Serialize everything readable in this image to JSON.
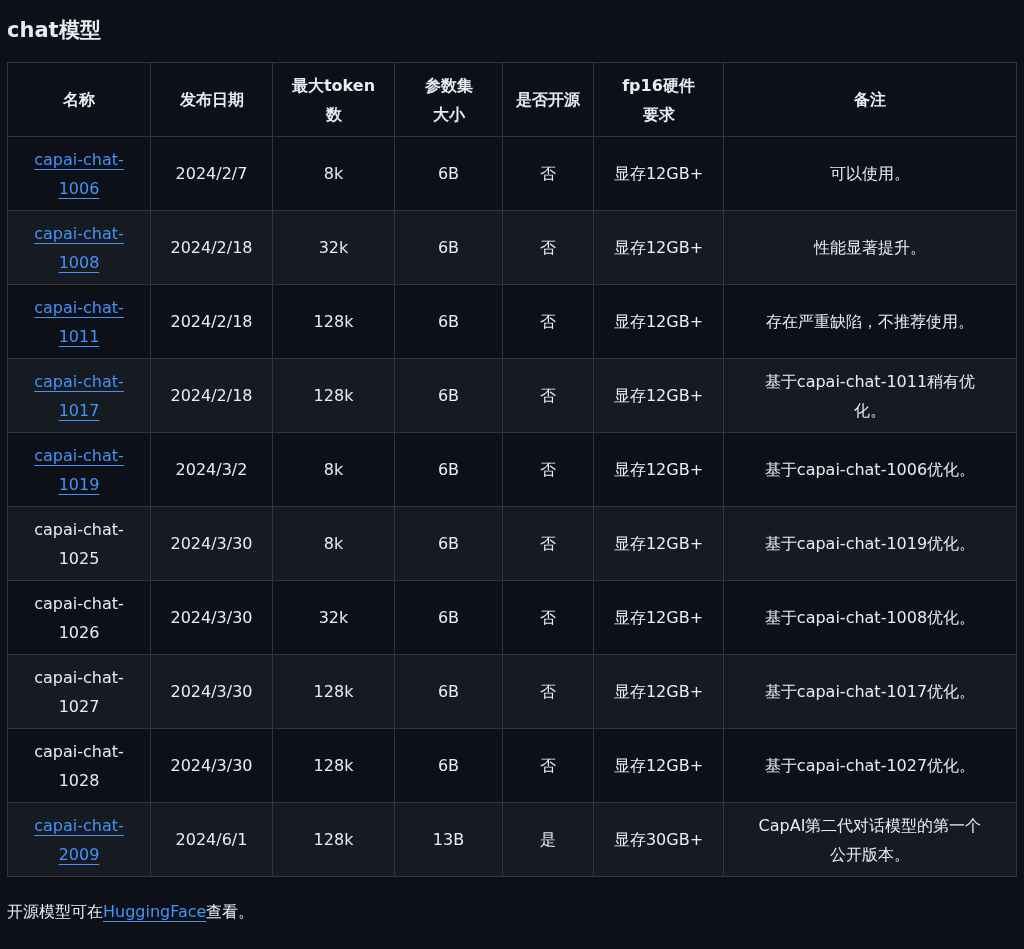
{
  "heading": "chat模型",
  "table": {
    "columns": [
      "名称",
      "发布日期",
      "最大token数",
      "参数集大小",
      "是否开源",
      "fp16硬件要求",
      "备注"
    ],
    "rows": [
      {
        "name": "capai-chat-1006",
        "link": true,
        "date": "2024/2/7",
        "tokens": "8k",
        "params": "6B",
        "open_source": "否",
        "hardware": "显存12GB+",
        "note": "可以使用。"
      },
      {
        "name": "capai-chat-1008",
        "link": true,
        "date": "2024/2/18",
        "tokens": "32k",
        "params": "6B",
        "open_source": "否",
        "hardware": "显存12GB+",
        "note": "性能显著提升。"
      },
      {
        "name": "capai-chat-1011",
        "link": true,
        "date": "2024/2/18",
        "tokens": "128k",
        "params": "6B",
        "open_source": "否",
        "hardware": "显存12GB+",
        "note": "存在严重缺陷，不推荐使用。"
      },
      {
        "name": "capai-chat-1017",
        "link": true,
        "date": "2024/2/18",
        "tokens": "128k",
        "params": "6B",
        "open_source": "否",
        "hardware": "显存12GB+",
        "note": "基于capai-chat-1011稍有优化。"
      },
      {
        "name": "capai-chat-1019",
        "link": true,
        "date": "2024/3/2",
        "tokens": "8k",
        "params": "6B",
        "open_source": "否",
        "hardware": "显存12GB+",
        "note": "基于capai-chat-1006优化。"
      },
      {
        "name": "capai-chat-1025",
        "link": false,
        "date": "2024/3/30",
        "tokens": "8k",
        "params": "6B",
        "open_source": "否",
        "hardware": "显存12GB+",
        "note": "基于capai-chat-1019优化。"
      },
      {
        "name": "capai-chat-1026",
        "link": false,
        "date": "2024/3/30",
        "tokens": "32k",
        "params": "6B",
        "open_source": "否",
        "hardware": "显存12GB+",
        "note": "基于capai-chat-1008优化。"
      },
      {
        "name": "capai-chat-1027",
        "link": false,
        "date": "2024/3/30",
        "tokens": "128k",
        "params": "6B",
        "open_source": "否",
        "hardware": "显存12GB+",
        "note": "基于capai-chat-1017优化。"
      },
      {
        "name": "capai-chat-1028",
        "link": false,
        "date": "2024/3/30",
        "tokens": "128k",
        "params": "6B",
        "open_source": "否",
        "hardware": "显存12GB+",
        "note": "基于capai-chat-1027优化。"
      },
      {
        "name": "capai-chat-2009",
        "link": true,
        "date": "2024/6/1",
        "tokens": "128k",
        "params": "13B",
        "open_source": "是",
        "hardware": "显存30GB+",
        "note": "CapAI第二代对话模型的第一个公开版本。"
      }
    ]
  },
  "footer": {
    "before": "开源模型可在",
    "link": "HuggingFace",
    "after": "查看。"
  }
}
